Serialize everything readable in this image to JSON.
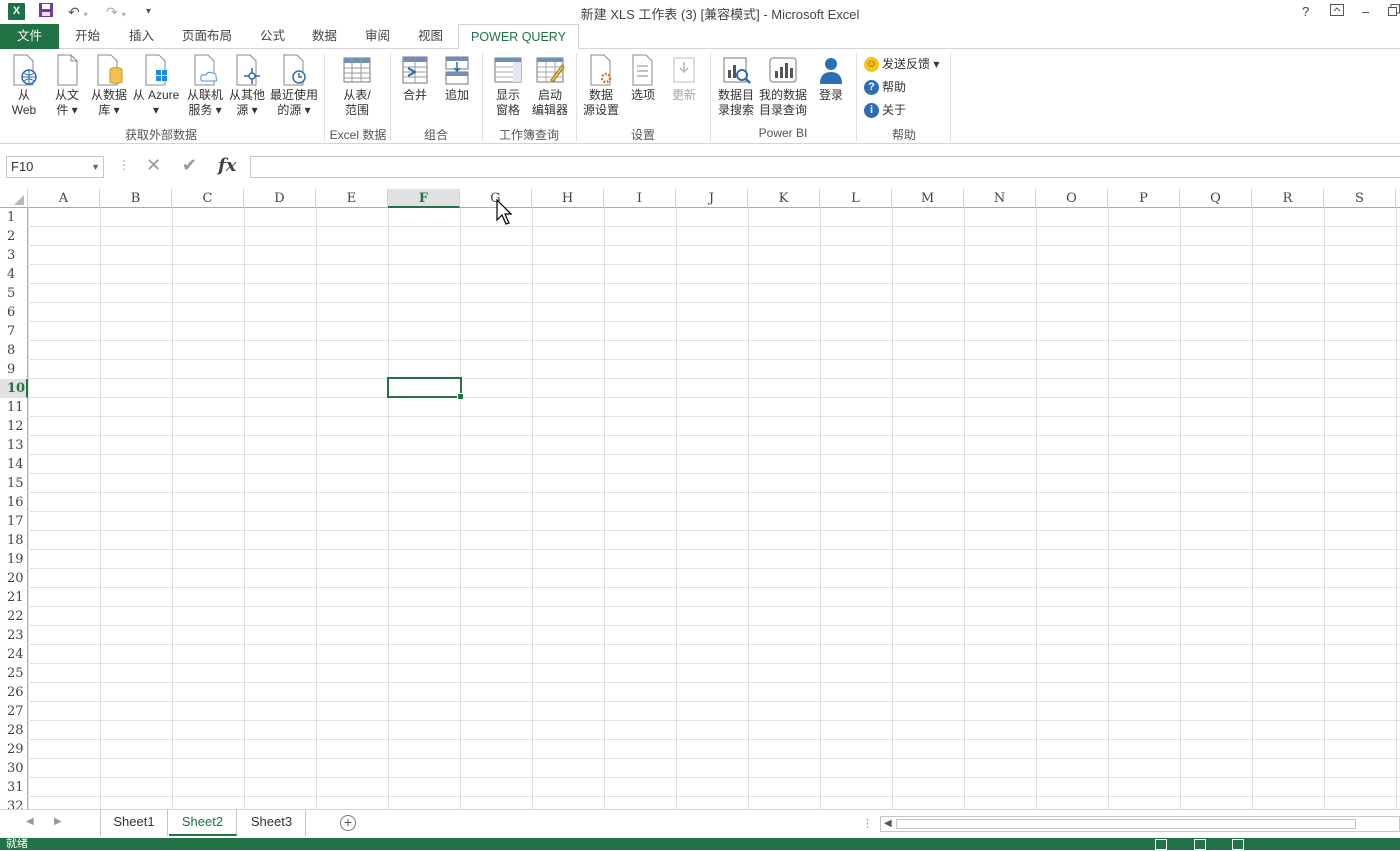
{
  "titlebar": {
    "title": "新建 XLS 工作表 (3)  [兼容模式] - Microsoft Excel",
    "help": "?",
    "minimize": "–"
  },
  "tabs": [
    "文件",
    "开始",
    "插入",
    "页面布局",
    "公式",
    "数据",
    "审阅",
    "视图",
    "POWER QUERY"
  ],
  "ribbon": {
    "get_external": {
      "label": "获取外部数据",
      "buttons": [
        {
          "line1": "从",
          "line2": "Web"
        },
        {
          "line1": "从文",
          "line2": "件 ▾"
        },
        {
          "line1": "从数据",
          "line2": "库 ▾"
        },
        {
          "line1": "从 Azure",
          "line2": "▾"
        },
        {
          "line1": "从联机",
          "line2": "服务 ▾"
        },
        {
          "line1": "从其他",
          "line2": "源 ▾"
        },
        {
          "line1": "最近使用",
          "line2": "的源 ▾"
        }
      ]
    },
    "excel_data": {
      "label": "Excel 数据",
      "button": {
        "line1": "从表/",
        "line2": "范围"
      }
    },
    "combine": {
      "label": "组合",
      "merge": "合并",
      "append": "追加"
    },
    "workbook_query": {
      "label": "工作簿查询",
      "show": {
        "line1": "显示",
        "line2": "窗格"
      },
      "launch": {
        "line1": "启动",
        "line2": "编辑器"
      }
    },
    "settings": {
      "label": "设置",
      "source": {
        "line1": "数据",
        "line2": "源设置"
      },
      "options": "选项",
      "update": "更新"
    },
    "powerbi": {
      "label": "Power BI",
      "catalog_search": {
        "line1": "数据目",
        "line2": "录搜索"
      },
      "my_catalog": {
        "line1": "我的数据",
        "line2": "目录查询"
      },
      "signin": "登录"
    },
    "help": {
      "label": "帮助",
      "feedback": "发送反馈 ▾",
      "help": "帮助",
      "about": "关于"
    }
  },
  "formula_bar": {
    "name_box": "F10",
    "formula": ""
  },
  "columns": [
    "A",
    "B",
    "C",
    "D",
    "E",
    "F",
    "G",
    "H",
    "I",
    "J",
    "K",
    "L",
    "M",
    "N",
    "O",
    "P",
    "Q",
    "R",
    "S"
  ],
  "rows": [
    "1",
    "2",
    "3",
    "4",
    "5",
    "6",
    "7",
    "8",
    "9",
    "10",
    "11",
    "12",
    "13",
    "14",
    "15",
    "16",
    "17",
    "18",
    "19",
    "20",
    "21",
    "22",
    "23",
    "24",
    "25",
    "26",
    "27",
    "28",
    "29",
    "30",
    "31",
    "32"
  ],
  "sheets": [
    "Sheet1",
    "Sheet2",
    "Sheet3"
  ],
  "status": {
    "ready": "就绪"
  },
  "colors": {
    "accent": "#217346"
  }
}
